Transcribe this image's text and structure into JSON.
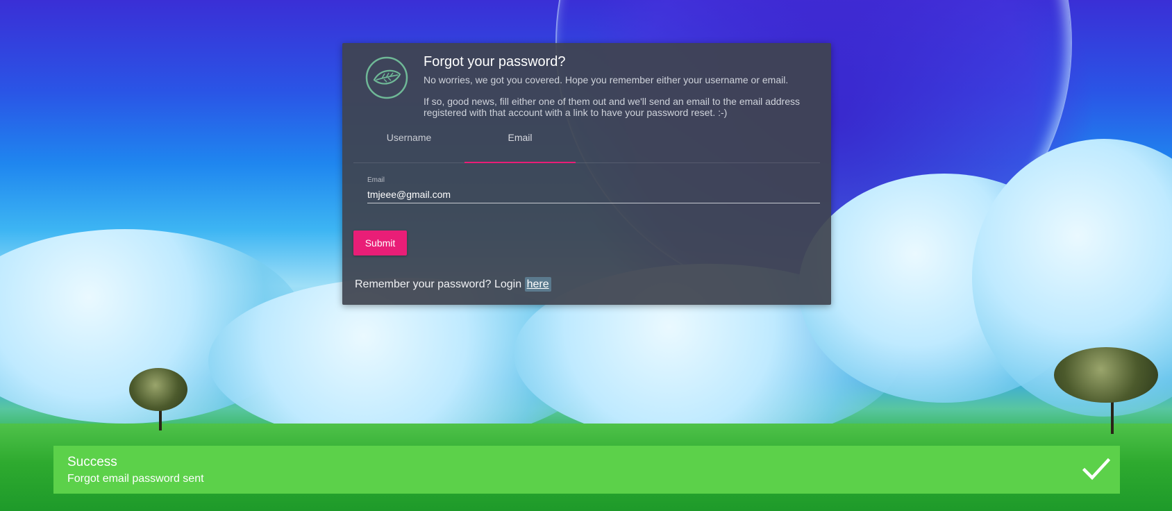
{
  "card": {
    "title": "Forgot your password?",
    "description_1": "No worries, we got you covered. Hope you remember either your username or email.",
    "description_2": "If so, good news, fill either one of them out and we'll send an email to the email address registered with that account with a link to have your password reset. :-)",
    "logo_icon": "leaf-icon",
    "accent_color": "#e91e77"
  },
  "tabs": [
    {
      "label": "Username",
      "active": false
    },
    {
      "label": "Email",
      "active": true
    }
  ],
  "form": {
    "email_label": "Email",
    "email_value": "tmjeee@gmail.com",
    "submit_label": "Submit"
  },
  "footer": {
    "remember_text": "Remember your password? Login ",
    "link_label": "here"
  },
  "toast": {
    "title": "Success",
    "message": "Forgot email password sent",
    "icon": "checkmark-icon",
    "color": "#5cd14a"
  }
}
